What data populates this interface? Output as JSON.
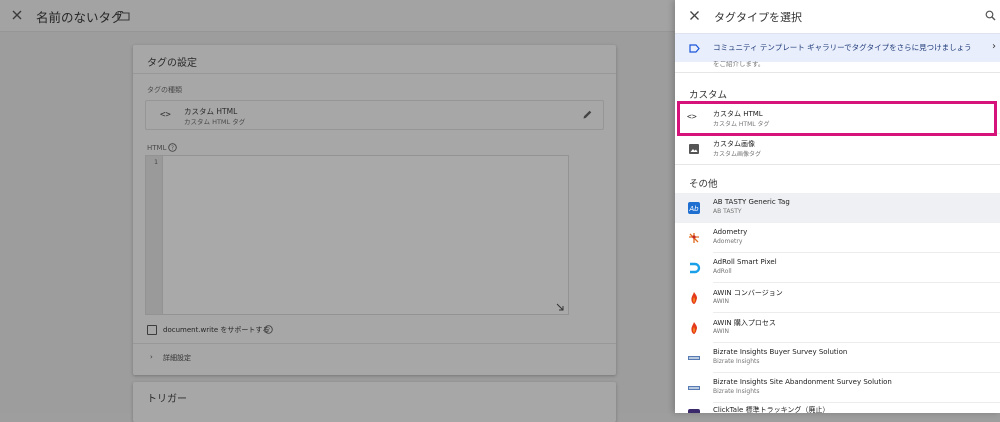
{
  "editor": {
    "tag_title": "名前のないタグ",
    "card": {
      "title": "タグの設定",
      "type_label": "タグの種類",
      "type_icon": "<>",
      "type_name": "カスタム HTML",
      "type_sub": "カスタム HTML タグ",
      "html_label": "HTML",
      "line_number": "1",
      "doc_write_label": "document.write をサポートする",
      "advanced_chevron": "›",
      "advanced_label": "詳細設定"
    },
    "trigger_title": "トリガー"
  },
  "panel": {
    "title": "タグタイプを選択",
    "banner_text": "コミュニティ テンプレート ギャラリーでタグタイプをさらに見つけましょう",
    "banner_chevron": "›",
    "clipped_text": "をご紹介します。",
    "custom_section": "カスタム",
    "custom_items": [
      {
        "name": "カスタム HTML",
        "sub": "カスタム HTML タグ",
        "icon": "code-icon",
        "glyph": "<>"
      },
      {
        "name": "カスタム画像",
        "sub": "カスタム画像タグ",
        "icon": "image-icon"
      }
    ],
    "other_section": "その他",
    "other_items": [
      {
        "name": "AB TASTY Generic Tag",
        "sub": "AB TASTY",
        "icon": "abtasty-logo-icon"
      },
      {
        "name": "Adometry",
        "sub": "Adometry",
        "icon": "adometry-logo-icon"
      },
      {
        "name": "AdRoll Smart Pixel",
        "sub": "AdRoll",
        "icon": "adroll-logo-icon"
      },
      {
        "name": "AWIN コンバージョン",
        "sub": "AWIN",
        "icon": "awin-logo-icon"
      },
      {
        "name": "AWIN 購入プロセス",
        "sub": "AWIN",
        "icon": "awin-logo-icon"
      },
      {
        "name": "Bizrate Insights Buyer Survey Solution",
        "sub": "Bizrate Insights",
        "icon": "bizrate-logo-icon"
      },
      {
        "name": "Bizrate Insights Site Abandonment Survey Solution",
        "sub": "Bizrate Insights",
        "icon": "bizrate-logo-icon"
      },
      {
        "name": "ClickTale 標準トラッキング（廃止）",
        "sub": "",
        "icon": "clicktale-logo-icon"
      }
    ]
  },
  "colors": {
    "highlight": "#d6127b",
    "banner_bg": "#e8eefb",
    "overlay_gray": "#9e9e9e"
  }
}
